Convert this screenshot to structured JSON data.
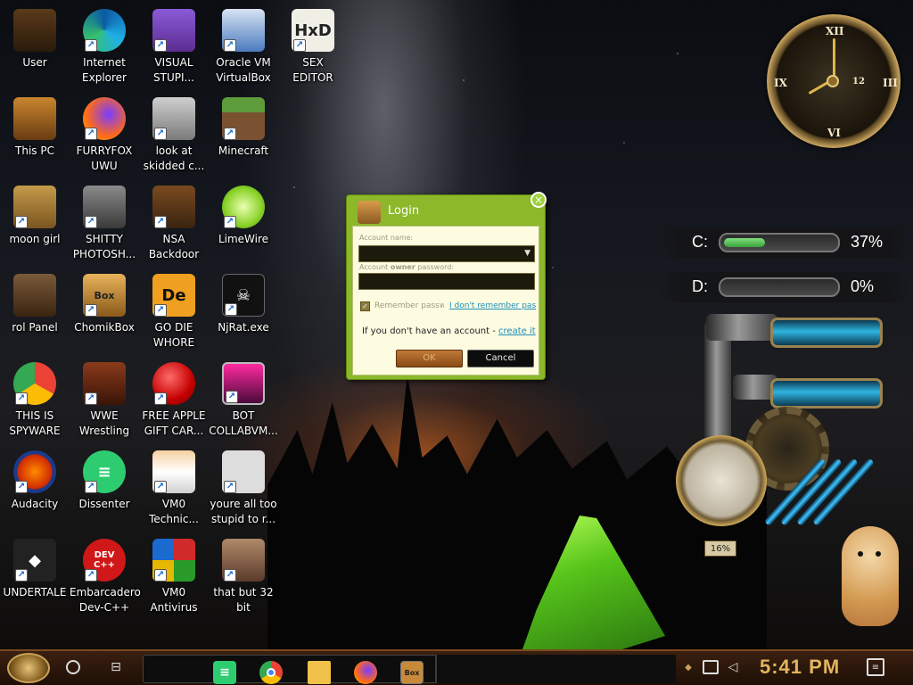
{
  "desktop_icons": [
    {
      "label": "User",
      "icon": "user-folder-icon"
    },
    {
      "label": "Internet\nExplorer",
      "icon": "edge-icon"
    },
    {
      "label": "VISUAL\nSTUPI...",
      "icon": "visual-studio-icon"
    },
    {
      "label": "Oracle VM\nVirtualBox",
      "icon": "virtualbox-icon"
    },
    {
      "label": "SEX\nEDITOR",
      "icon": "hxd-icon"
    },
    {
      "label": "This PC",
      "icon": "computer-icon"
    },
    {
      "label": "FURRYFOX\nUWU",
      "icon": "firefox-icon"
    },
    {
      "label": "look at\nskidded c...",
      "icon": "folder-stack-icon"
    },
    {
      "label": "Minecraft",
      "icon": "minecraft-icon"
    },
    {
      "label": "moon girl",
      "icon": "document-icon"
    },
    {
      "label": "SHITTY\nPHOTOSH...",
      "icon": "gimp-icon"
    },
    {
      "label": "NSA\nBackdoor",
      "icon": "nsa-backdoor-icon"
    },
    {
      "label": "LimeWire",
      "icon": "limewire-icon"
    },
    {
      "label": "rol Panel",
      "icon": "control-panel-icon"
    },
    {
      "label": "ChomikBox",
      "icon": "chomikbox-icon"
    },
    {
      "label": "GO DIE\nWHORE",
      "icon": "die-icon"
    },
    {
      "label": "NjRat.exe",
      "icon": "skull-icon"
    },
    {
      "label": "THIS IS\nSPYWARE",
      "icon": "chrome-icon"
    },
    {
      "label": "WWE\nWrestling",
      "icon": "oven-icon"
    },
    {
      "label": "FREE APPLE\nGIFT CAR...",
      "icon": "apple-icon"
    },
    {
      "label": "BOT\nCOLLABVM...",
      "icon": "bot-icon"
    },
    {
      "label": "Audacity",
      "icon": "audacity-icon"
    },
    {
      "label": "Dissenter",
      "icon": "dissenter-icon"
    },
    {
      "label": "VM0\nTechnic...",
      "icon": "technician-icon"
    },
    {
      "label": "youre all too\nstupid to r...",
      "icon": "portrait-icon"
    },
    {
      "label": "UNDERTALE",
      "icon": "unity-icon"
    },
    {
      "label": "Embarcadero\nDev-C++",
      "icon": "devcpp-icon"
    },
    {
      "label": "VM0\nAntivirus",
      "icon": "shield-icon"
    },
    {
      "label": "that but 32\nbit",
      "icon": "portrait2-icon"
    }
  ],
  "login_dialog": {
    "title": "Login",
    "account_name_label": "Account name:",
    "password_label_pre": "Account ",
    "password_label_bold": "owner",
    "password_label_post": " password:",
    "remember_label": "Remember passw",
    "forgot_link": "I don't remember pas",
    "no_account_text": "If you don't have an account - ",
    "create_link": "create it",
    "ok_label": "OK",
    "cancel_label": "Cancel",
    "remember_checked": true
  },
  "drive_meters": [
    {
      "label": "C:",
      "percent_text": "37%",
      "fraction": 0.37
    },
    {
      "label": "D:",
      "percent_text": "0%",
      "fraction": 0.0
    }
  ],
  "clock": {
    "numeral_12": "XII",
    "numeral_3": "III",
    "numeral_6": "VI",
    "numeral_9": "IX",
    "sub_dial": "12"
  },
  "gauge": {
    "percent_text": "16%"
  },
  "taskbar": {
    "time": "5:41 PM",
    "pinned": [
      "dissenter-icon",
      "chrome-icon",
      "file-explorer-icon",
      "firefox-icon",
      "chomikbox-icon"
    ]
  }
}
